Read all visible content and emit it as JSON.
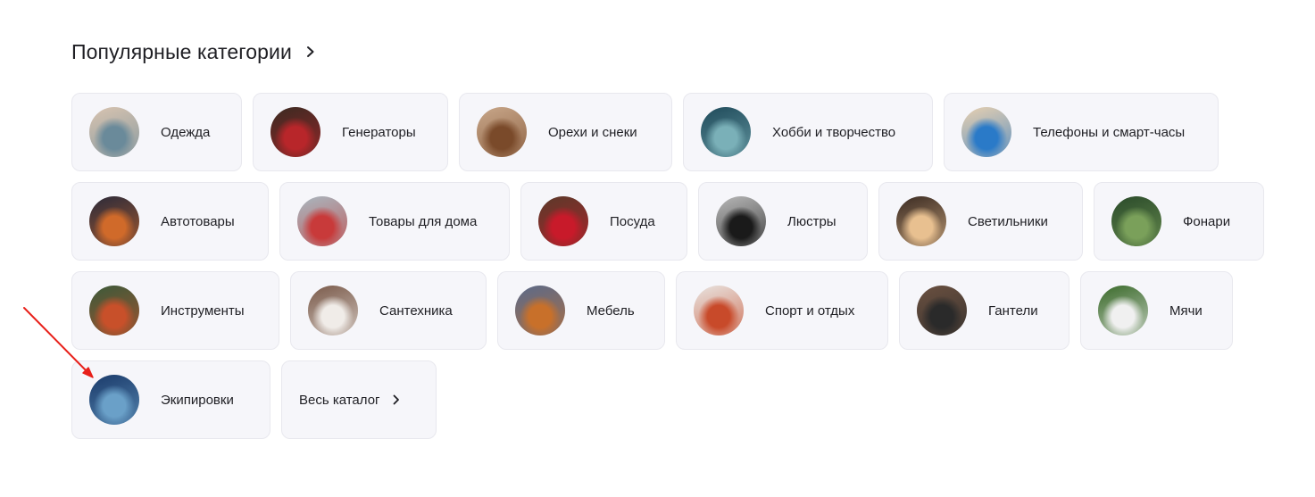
{
  "section": {
    "title": "Популярные категории",
    "chevron_icon": "chevron-right-icon"
  },
  "categories": [
    [
      {
        "name": "clothing",
        "label": "Одежда",
        "bg": [
          "#d9c4b0",
          "#6a8a9a"
        ]
      },
      {
        "name": "generators",
        "label": "Генераторы",
        "bg": [
          "#3a2a22",
          "#b8262a"
        ]
      },
      {
        "name": "nuts-snacks",
        "label": "Орехи и снеки",
        "bg": [
          "#c8a78a",
          "#7a4a2a"
        ]
      },
      {
        "name": "hobby",
        "label": "Хобби и творчество",
        "bg": [
          "#1f4a5a",
          "#7ab0b8"
        ]
      },
      {
        "name": "phones",
        "label": "Телефоны и смарт-часы",
        "bg": [
          "#e8d0b0",
          "#2a7ac8"
        ]
      }
    ],
    [
      {
        "name": "auto",
        "label": "Автотовары",
        "bg": [
          "#2a2a3a",
          "#d06a2a"
        ]
      },
      {
        "name": "home-goods",
        "label": "Товары для дома",
        "bg": [
          "#a8b8c0",
          "#c83a3a"
        ]
      },
      {
        "name": "dishes",
        "label": "Посуда",
        "bg": [
          "#5a3a2a",
          "#c81a2a"
        ]
      },
      {
        "name": "chandeliers",
        "label": "Люстры",
        "bg": [
          "#b8b8b8",
          "#1a1a1a"
        ]
      },
      {
        "name": "lamps",
        "label": "Светильники",
        "bg": [
          "#3a2a22",
          "#e8c090"
        ]
      },
      {
        "name": "lanterns",
        "label": "Фонари",
        "bg": [
          "#2a4a2a",
          "#7aa05a"
        ]
      }
    ],
    [
      {
        "name": "tools",
        "label": "Инструменты",
        "bg": [
          "#3a5a3a",
          "#c8502a"
        ]
      },
      {
        "name": "plumbing",
        "label": "Сантехника",
        "bg": [
          "#7a5a4a",
          "#f0ece8"
        ]
      },
      {
        "name": "furniture",
        "label": "Мебель",
        "bg": [
          "#5a6a8a",
          "#c8702a"
        ]
      },
      {
        "name": "sport",
        "label": "Спорт и отдых",
        "bg": [
          "#e8e4e0",
          "#c84a2a"
        ]
      },
      {
        "name": "dumbbells",
        "label": "Гантели",
        "bg": [
          "#6a5040",
          "#2a2a2a"
        ]
      },
      {
        "name": "balls",
        "label": "Мячи",
        "bg": [
          "#3a6a2a",
          "#f0f0f0"
        ]
      }
    ],
    [
      {
        "name": "equipment",
        "label": "Экипировки",
        "bg": [
          "#1a3a6a",
          "#6aa0c8"
        ]
      }
    ]
  ],
  "catalog": {
    "label": "Весь каталог",
    "icon": "chevron-right-icon"
  },
  "colors": {
    "card_bg": "#f6f6fa",
    "card_border": "#e8e8ee",
    "text": "#1f1f24",
    "annotation_arrow": "#e8201a"
  }
}
